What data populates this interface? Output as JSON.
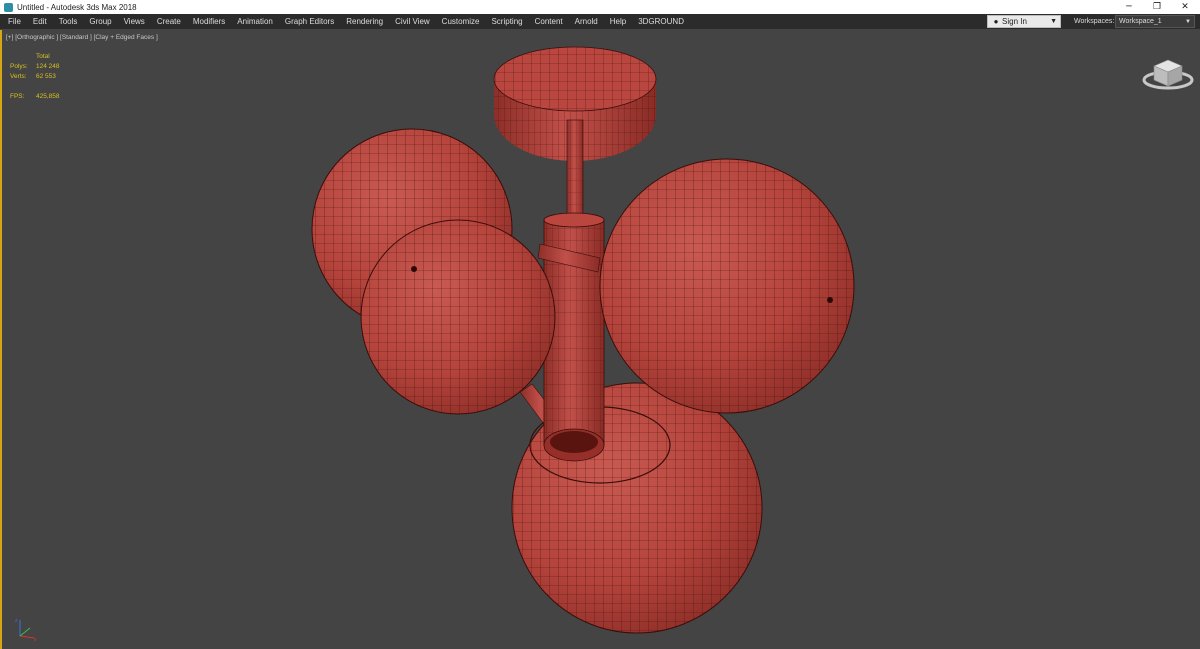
{
  "titlebar": {
    "title": "Untitled - Autodesk 3ds Max 2018",
    "minimize": "─",
    "restore": "❐",
    "close": "✕"
  },
  "menu": [
    "File",
    "Edit",
    "Tools",
    "Group",
    "Views",
    "Create",
    "Modifiers",
    "Animation",
    "Graph Editors",
    "Rendering",
    "Civil View",
    "Customize",
    "Scripting",
    "Content",
    "Arnold",
    "Help",
    "3DGROUND"
  ],
  "signin": {
    "label": "Sign In",
    "icon": "user-icon"
  },
  "workspace": {
    "label": "Workspaces:",
    "value": "Workspace_1"
  },
  "viewport": {
    "label": "[+] [Orthographic ] [Standard ] [Clay + Edged Faces ]",
    "stats": {
      "total": "Total",
      "polys_label": "Polys:",
      "polys_value": "124 248",
      "verts_label": "Verts:",
      "verts_value": "62 553",
      "fps_label": "FPS:",
      "fps_value": "425,858"
    }
  },
  "colors": {
    "clay": "#b8433c",
    "wire": "#3a0d0a",
    "background": "#444444",
    "accent": "#d6a614",
    "stats": "#d8c020"
  }
}
